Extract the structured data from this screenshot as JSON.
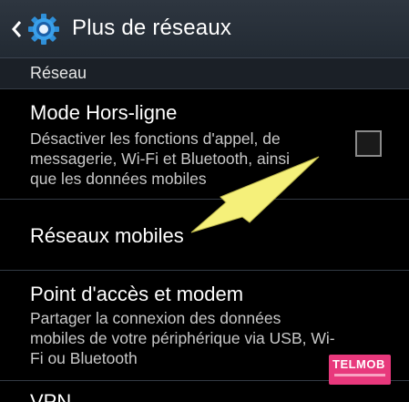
{
  "header": {
    "title": "Plus de réseaux",
    "back_icon": "chevron-left-icon",
    "app_icon": "settings-gear-icon"
  },
  "section": {
    "label": "Réseau"
  },
  "items": [
    {
      "title": "Mode Hors-ligne",
      "description": [
        "Désactiver les fonctions d'appel, de",
        "messagerie, Wi-Fi et Bluetooth, ainsi",
        "que les données mobiles"
      ],
      "checked": false
    },
    {
      "title": "Réseaux mobiles"
    },
    {
      "title": "Point d'accès et modem",
      "description": [
        "Partager la connexion des données",
        "mobiles de votre périphérique via USB, Wi-",
        "Fi ou Bluetooth"
      ]
    },
    {
      "title": "VPN"
    }
  ],
  "annotation": {
    "arrow_color": "#f5f07a"
  },
  "watermark": {
    "text": "TELMOB",
    "color": "#e8387c"
  }
}
